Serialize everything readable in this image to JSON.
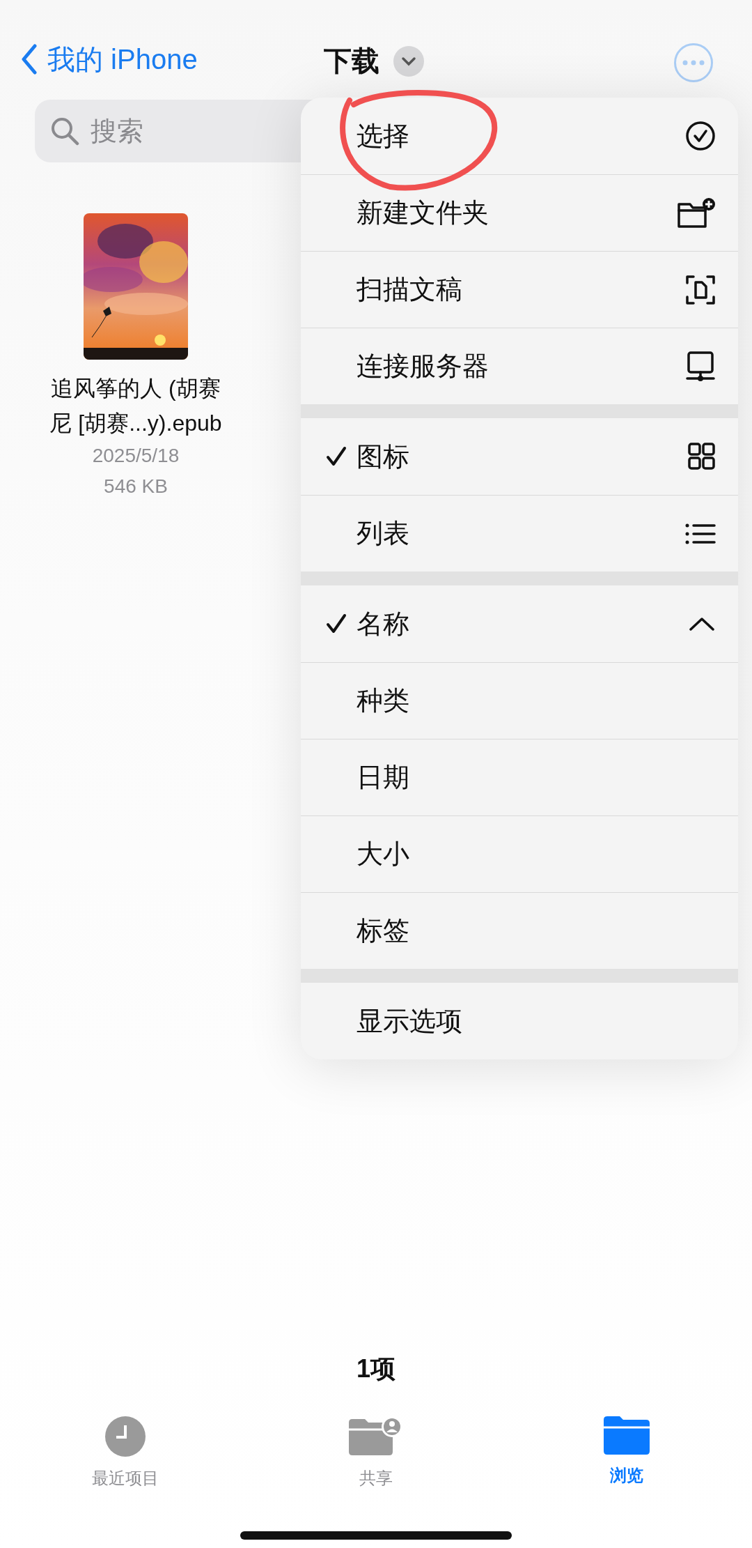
{
  "nav": {
    "back_label": "我的 iPhone",
    "title": "下载"
  },
  "search": {
    "placeholder": "搜索"
  },
  "files": [
    {
      "name": "追风筝的人 (胡赛尼 [胡赛...y).epub",
      "date": "2025/5/18",
      "size": "546 KB",
      "kind": "picture"
    }
  ],
  "menu": {
    "sections": [
      {
        "items": [
          {
            "label": "选择",
            "circled": true
          },
          {
            "label": "新建文件夹",
            "circled": false
          },
          {
            "label": "扫描文稿",
            "circled": false
          },
          {
            "label": "连接服务器",
            "circled": false
          }
        ]
      },
      {
        "items": [
          {
            "label": "图标",
            "checked": true,
            "circled": false
          },
          {
            "label": "列表",
            "checked": false,
            "circled": false
          }
        ]
      },
      {
        "items": [
          {
            "label": "名称",
            "checked": true,
            "circled": false
          },
          {
            "label": "种类",
            "checked": false,
            "circled": false
          },
          {
            "label": "日期",
            "checked": false,
            "circled": false
          },
          {
            "label": "大小",
            "checked": false,
            "circled": false
          },
          {
            "label": "标签",
            "checked": false,
            "circled": false
          }
        ]
      },
      {
        "items": [
          {
            "label": "显示选项",
            "circled": false
          }
        ]
      }
    ]
  },
  "item_count": "1项",
  "tabs": [
    {
      "label": "最近项目",
      "selected": false
    },
    {
      "label": "共享",
      "selected": false
    },
    {
      "label": "浏览",
      "selected": true
    }
  ]
}
